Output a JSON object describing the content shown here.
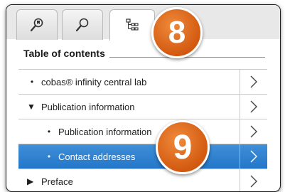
{
  "tabs": [
    {
      "icon": "bookmark-search-icon",
      "active": false
    },
    {
      "icon": "search-icon",
      "active": false
    },
    {
      "icon": "table-of-contents-icon",
      "active": true
    }
  ],
  "callouts": {
    "badge_top": "8",
    "badge_bottom": "9",
    "color": "#e06a1a"
  },
  "toc": {
    "heading": "Table of contents",
    "items": [
      {
        "label": "cobas® infinity central lab",
        "marker": "•",
        "level": 0,
        "selected": false
      },
      {
        "label": "Publication information",
        "marker": "▼",
        "level": 0,
        "selected": false
      },
      {
        "label": "Publication information",
        "marker": "•",
        "level": 1,
        "selected": false
      },
      {
        "label": "Contact addresses",
        "marker": "•",
        "level": 1,
        "selected": true
      },
      {
        "label": "Preface",
        "marker": "▶",
        "level": 0,
        "selected": false
      }
    ]
  },
  "colors": {
    "selected_row": "#2a7cd0",
    "border": "#c9c9c9"
  }
}
